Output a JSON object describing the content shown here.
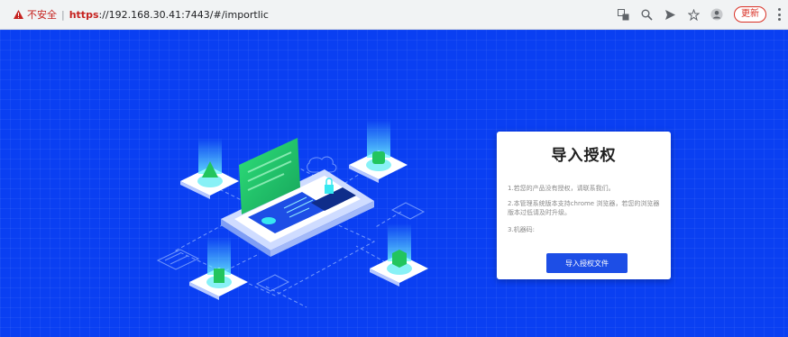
{
  "browser": {
    "insecure_label": "不安全",
    "divider": "|",
    "url_scheme": "https",
    "url_rest": "://192.168.30.41:7443/#/importlic",
    "update_label": "更新",
    "icons": [
      "translate-icon",
      "zoom-icon",
      "send-icon",
      "star-icon",
      "profile-icon"
    ]
  },
  "card": {
    "title": "导入授权",
    "line1": "1.若您的产品没有授权，请联系我们。",
    "line2": "2.本管理系统版本支持chrome 浏览器，若您的浏览器版本过低请及时升级。",
    "line3": "3.机器码:",
    "button_label": "导入授权文件"
  },
  "colors": {
    "background": "#0a3ff2",
    "button": "#1d4ee6",
    "warning": "#c5221f",
    "accent_green": "#22c55e",
    "accent_cyan": "#38e8f0"
  }
}
